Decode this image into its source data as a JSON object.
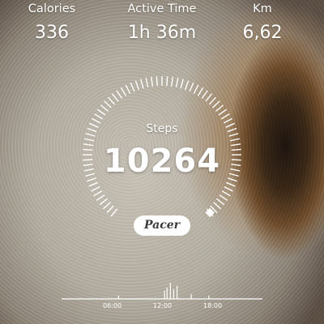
{
  "stats": {
    "calories": {
      "label": "Calories",
      "value": "336"
    },
    "active_time": {
      "label": "Active Time",
      "value": "1h 36m"
    },
    "distance": {
      "label": "Km",
      "value": "6,62"
    }
  },
  "steps": {
    "label": "Steps",
    "value": "10264",
    "goal_progress": 1.0
  },
  "brand": {
    "label": "Pacer"
  },
  "timeline": {
    "labels": [
      "06:00",
      "12:00",
      "18:00"
    ],
    "activity_hours": [
      6.8,
      12.3,
      12.6,
      13.0,
      13.4,
      13.8,
      15.5,
      17.6
    ]
  },
  "colors": {
    "text": "#ffffff",
    "pill_bg": "#ffffff",
    "pill_text": "#3a3a3a"
  }
}
